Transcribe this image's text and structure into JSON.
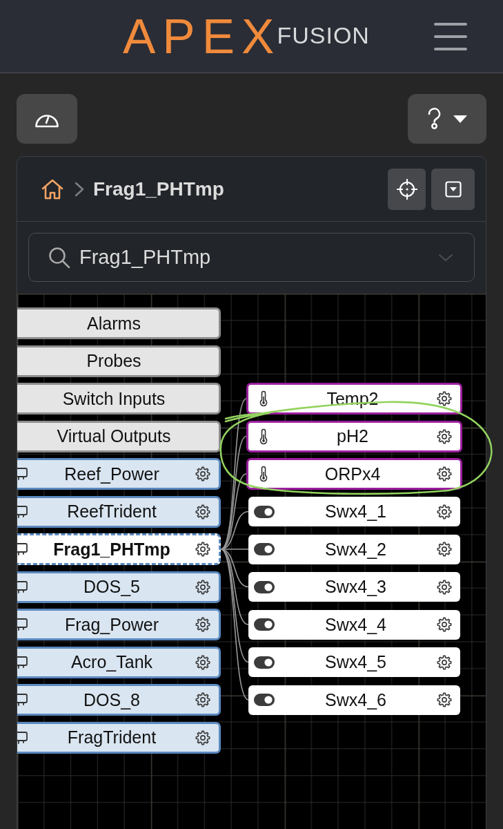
{
  "header": {
    "logo": "APEX",
    "logo_suffix": "FUSION"
  },
  "breadcrumb": {
    "current": "Frag1_PHTmp"
  },
  "search": {
    "value": "Frag1_PHTmp"
  },
  "canvas": {
    "left_nodes": [
      {
        "label": "Alarms",
        "kind": "category",
        "selected": false
      },
      {
        "label": "Probes",
        "kind": "category",
        "selected": false
      },
      {
        "label": "Switch Inputs",
        "kind": "category",
        "selected": false
      },
      {
        "label": "Virtual Outputs",
        "kind": "category",
        "selected": false
      },
      {
        "label": "Reef_Power",
        "kind": "device",
        "selected": false
      },
      {
        "label": "ReefTrident",
        "kind": "device",
        "selected": false
      },
      {
        "label": "Frag1_PHTmp",
        "kind": "device",
        "selected": true
      },
      {
        "label": "DOS_5",
        "kind": "device",
        "selected": false
      },
      {
        "label": "Frag_Power",
        "kind": "device",
        "selected": false
      },
      {
        "label": "Acro_Tank",
        "kind": "device",
        "selected": false
      },
      {
        "label": "DOS_8",
        "kind": "device",
        "selected": false
      },
      {
        "label": "FragTrident",
        "kind": "device",
        "selected": false
      }
    ],
    "right_nodes": [
      {
        "label": "Temp2",
        "kind": "probe"
      },
      {
        "label": "pH2",
        "kind": "probe"
      },
      {
        "label": "ORPx4",
        "kind": "probe"
      },
      {
        "label": "Swx4_1",
        "kind": "switch"
      },
      {
        "label": "Swx4_2",
        "kind": "switch"
      },
      {
        "label": "Swx4_3",
        "kind": "switch"
      },
      {
        "label": "Swx4_4",
        "kind": "switch"
      },
      {
        "label": "Swx4_5",
        "kind": "switch"
      },
      {
        "label": "Swx4_6",
        "kind": "switch"
      }
    ]
  }
}
